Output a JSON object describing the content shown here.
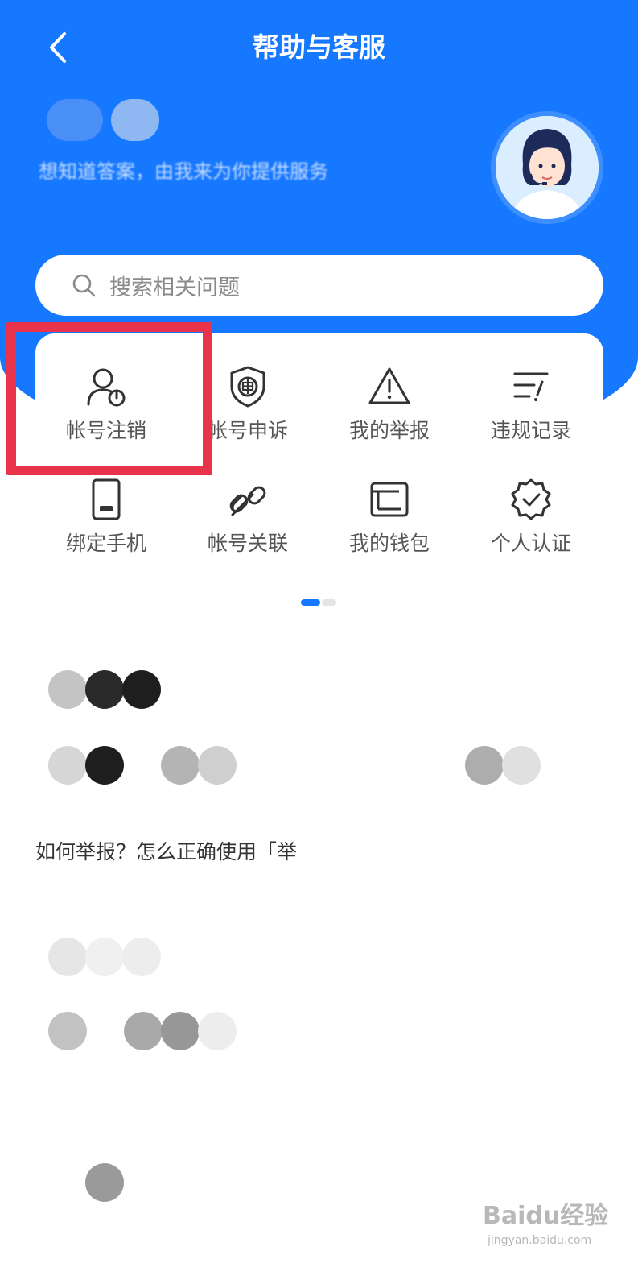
{
  "header": {
    "title": "帮助与客服",
    "back_icon": "chevron-left-icon",
    "greeting_subtitle": "想知道答案，由我来为你提供服务"
  },
  "search": {
    "placeholder": "搜索相关问题",
    "icon": "search-icon"
  },
  "quick_services": {
    "items": [
      {
        "label": "帐号注销",
        "icon": "user-power-icon"
      },
      {
        "label": "帐号申诉",
        "icon": "shield-appeal-icon"
      },
      {
        "label": "我的举报",
        "icon": "warning-triangle-icon"
      },
      {
        "label": "违规记录",
        "icon": "list-record-icon"
      },
      {
        "label": "绑定手机",
        "icon": "phone-icon"
      },
      {
        "label": "帐号关联",
        "icon": "link-icon"
      },
      {
        "label": "我的钱包",
        "icon": "wallet-icon"
      },
      {
        "label": "个人认证",
        "icon": "verified-badge-icon"
      }
    ],
    "page_indicator": {
      "current": 1,
      "total": 2
    }
  },
  "faq": {
    "items": [
      {
        "text": "如何举报？怎么正确使用「举"
      }
    ]
  },
  "watermark": {
    "main": "Baidu经验",
    "sub": "jingyan.baidu.com"
  },
  "colors": {
    "brand_blue": "#1677ff",
    "highlight_red": "#e8334a"
  }
}
